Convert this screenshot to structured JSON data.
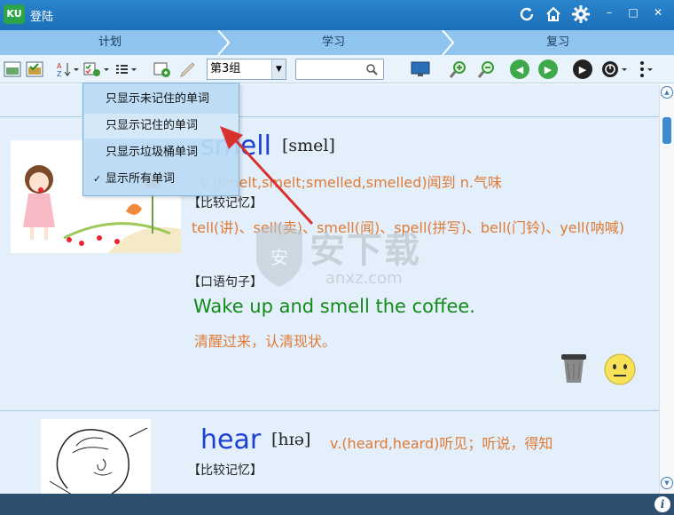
{
  "window": {
    "logo_text": "KU",
    "title": "登陆",
    "controls": {
      "minimize": "–",
      "maximize": "□",
      "close": "✕"
    }
  },
  "tabs": [
    {
      "label": "计划"
    },
    {
      "label": "学习"
    },
    {
      "label": "复习"
    }
  ],
  "toolbar": {
    "group_select_value": "第3组",
    "search_value": ""
  },
  "filter_menu": {
    "items": [
      {
        "label": "只显示未记住的单词",
        "checked": false
      },
      {
        "label": "只显示记住的单词",
        "checked": false
      },
      {
        "label": "只显示垃圾桶单词",
        "checked": false
      },
      {
        "label": "显示所有单词",
        "checked": true
      }
    ],
    "check_glyph": "✓"
  },
  "entries": [
    {
      "word": "smell",
      "phonetic": "[smel]",
      "definition": "v.(smelt,smelt;smelled,smelled)闻到 n.气味",
      "compare_heading": "【比较记忆】",
      "compare_text": "tell(讲)、sell(卖)、smell(闻)、spell(拼写)、bell(门铃)、yell(呐喊)",
      "sentence_heading": "【口语句子】",
      "sentence": "Wake up and smell the coffee.",
      "translation": "清醒过来，认清现状。"
    },
    {
      "word": "hear",
      "phonetic": "[hɪə]",
      "definition": "v.(heard,heard)听见；听说，得知",
      "compare_heading": "【比较记忆】"
    }
  ],
  "watermark": {
    "text": "安下载",
    "sub": "anxz.com"
  },
  "statusbar": {
    "info_glyph": "i"
  },
  "colors": {
    "titlebar": "#1b6fb8",
    "tabs": "#8fc4ef",
    "headword": "#1d3fd6",
    "definition": "#e07a35",
    "sentence": "#128a18",
    "arrow": "#d9312e"
  }
}
